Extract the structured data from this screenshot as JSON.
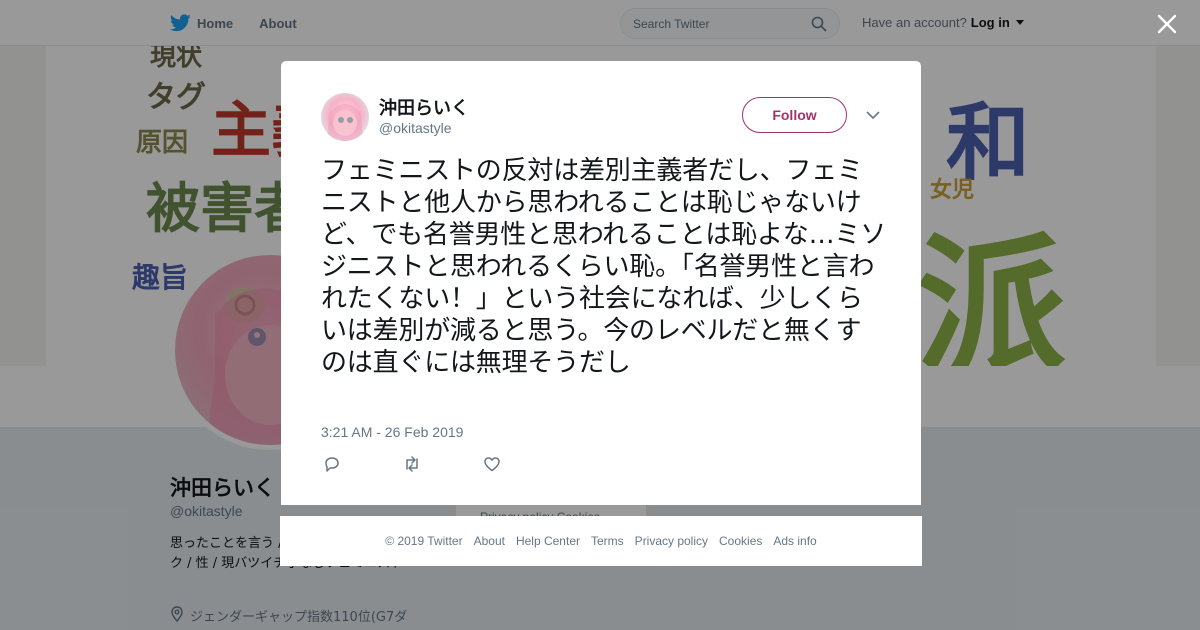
{
  "nav": {
    "home": "Home",
    "about": "About",
    "search_placeholder": "Search Twitter",
    "have_account": "Have an account?",
    "login": "Log in"
  },
  "banner_words": [
    {
      "text": "現状",
      "color": "#6d6a4a"
    },
    {
      "text": "タグ",
      "color": "#6d6a4a"
    },
    {
      "text": "原因",
      "color": "#8c8a4e"
    },
    {
      "text": "被害者",
      "color": "#6d8a4e"
    },
    {
      "text": "主義",
      "color": "#c0392b"
    },
    {
      "text": "趣旨",
      "color": "#4b62b0"
    },
    {
      "text": "和",
      "color": "#4b62b0"
    },
    {
      "text": "女児",
      "color": "#c8a03a"
    },
    {
      "text": "派",
      "color": "#8db34a"
    }
  ],
  "profile": {
    "name": "沖田らいく",
    "handle": "@okitastyle",
    "bio": "思ったことを言う / 言うよ（笑） by元オタク / 性 / 現バツイチ子なしフェミニスト",
    "location": "ジェンダーギャップ指数110位(G7ダ",
    "side_links": "Privacy policy  Cookies"
  },
  "tweet": {
    "name": "沖田らいく",
    "handle": "@okitastyle",
    "follow_label": "Follow",
    "text": "フェミニストの反対は差別主義者だし、フェミニストと他人から思われることは恥じゃないけど、でも名誉男性と思われることは恥よな…ミソジニストと思われるくらい恥。「名誉男性と言われたくない！」という社会になれば、少しくらいは差別が減ると思う。今のレベルだと無くすのは直ぐには無理そうだし",
    "timestamp": "3:21 AM - 26 Feb 2019"
  },
  "footer": {
    "copyright": "© 2019 Twitter",
    "about": "About",
    "help": "Help Center",
    "terms": "Terms",
    "privacy": "Privacy policy",
    "cookies": "Cookies",
    "ads": "Ads info"
  },
  "colors": {
    "follow_accent": "#a1346a",
    "twitter_blue": "#1da1f2",
    "muted": "#657786"
  },
  "icons": [
    "twitter-bird-icon",
    "home-icon",
    "search-icon",
    "caret-down-icon",
    "close-icon",
    "chevron-down-icon",
    "reply-icon",
    "retweet-icon",
    "like-icon",
    "location-icon"
  ]
}
